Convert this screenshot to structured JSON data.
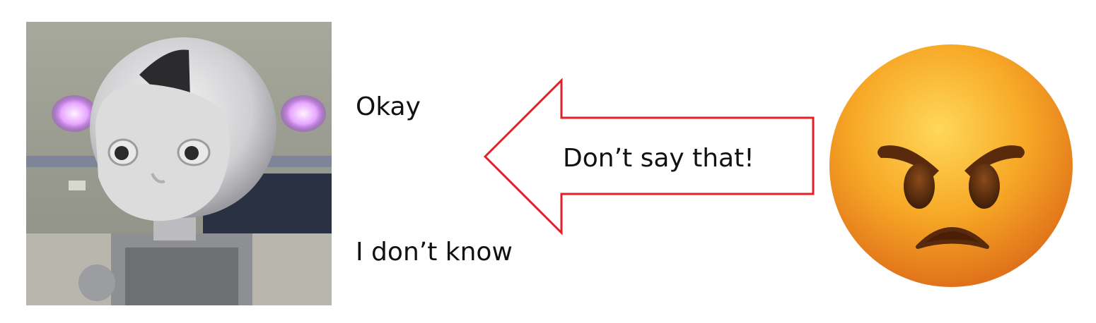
{
  "responses": {
    "option_1": "Okay",
    "option_2": "I don’t know"
  },
  "feedback": {
    "text": "Don’t say that!",
    "arrow_color": "#e3202a"
  },
  "images": {
    "robot": "robot-head-photo",
    "emoji": "angry-face-emoji"
  }
}
